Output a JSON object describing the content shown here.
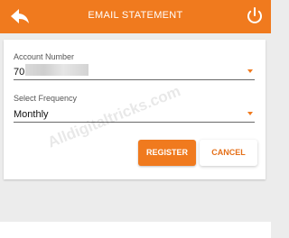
{
  "app_bar": {
    "title": "EMAIL STATEMENT",
    "back_icon": "back-arrow-icon",
    "power_icon": "power-icon",
    "color": "#f07a1e"
  },
  "form": {
    "account_number": {
      "label": "Account Number",
      "value_visible": "70"
    },
    "frequency": {
      "label": "Select Frequency",
      "value": "Monthly"
    }
  },
  "buttons": {
    "register": "REGISTER",
    "cancel": "CANCEL"
  },
  "watermark": "Alldigitaltricks.com"
}
